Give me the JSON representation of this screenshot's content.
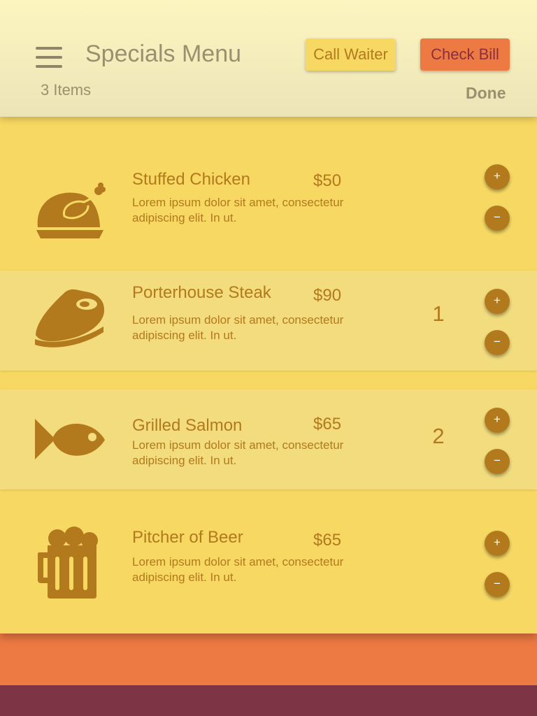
{
  "header": {
    "title": "Specials Menu",
    "item_count": "3 Items",
    "call_waiter_label": "Call Waiter",
    "check_bill_label": "Check Bill",
    "done_label": "Done"
  },
  "menu": {
    "items": [
      {
        "name": "Stuffed Chicken",
        "price": "$50",
        "description": "Lorem ipsum dolor sit amet, consectetur adipiscing elit. In ut.",
        "quantity": "",
        "icon": "chicken-icon",
        "plus": "+",
        "minus": "−"
      },
      {
        "name": "Porterhouse Steak",
        "price": "$90",
        "description": "Lorem ipsum dolor sit amet, consectetur adipiscing elit. In ut.",
        "quantity": "1",
        "icon": "steak-icon",
        "plus": "+",
        "minus": "−"
      },
      {
        "name": "Grilled Salmon",
        "price": "$65",
        "description": "Lorem ipsum dolor sit amet, consectetur adipiscing elit. In ut.",
        "quantity": "2",
        "icon": "fish-icon",
        "plus": "+",
        "minus": "−"
      },
      {
        "name": "Pitcher of Beer",
        "price": "$65",
        "description": "Lorem ipsum dolor sit amet, consectetur adipiscing elit. In ut.",
        "quantity": "",
        "icon": "beer-icon",
        "plus": "+",
        "minus": "−"
      }
    ]
  },
  "colors": {
    "accent": "#b27a1d",
    "panel": "#f6d862",
    "panel_alt": "#f2dc7e",
    "orange": "#ee7a43",
    "maroon": "#7d3546",
    "header_text": "#9a9070"
  }
}
